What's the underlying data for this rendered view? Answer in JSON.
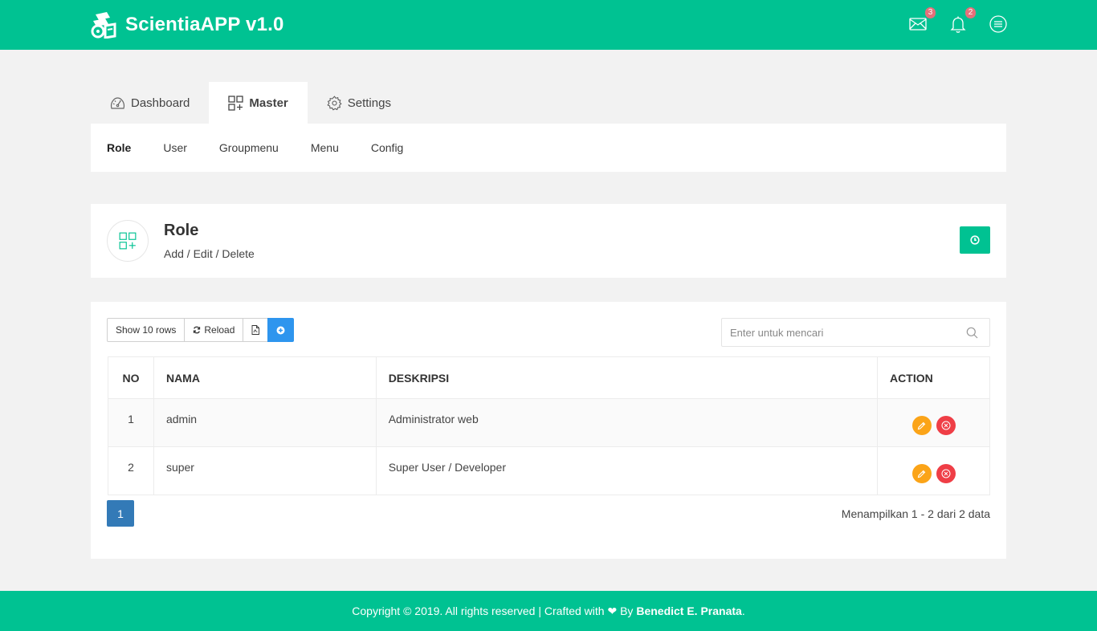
{
  "app": {
    "title": "ScientiaAPP v1.0"
  },
  "header": {
    "mail_count": "3",
    "notif_count": "2"
  },
  "tabs": [
    {
      "label": "Dashboard",
      "icon": "dashboard-gauge-icon"
    },
    {
      "label": "Master",
      "icon": "master-grid-icon",
      "active": true
    },
    {
      "label": "Settings",
      "icon": "gear-icon"
    }
  ],
  "subnav": [
    {
      "label": "Role",
      "active": true
    },
    {
      "label": "User"
    },
    {
      "label": "Groupmenu"
    },
    {
      "label": "Menu"
    },
    {
      "label": "Config"
    }
  ],
  "page": {
    "title": "Role",
    "subtitle": "Add / Edit / Delete"
  },
  "toolbar": {
    "show_rows": "Show 10 rows",
    "reload": "Reload"
  },
  "search": {
    "placeholder": "Enter untuk mencari"
  },
  "table": {
    "headers": [
      "NO",
      "NAMA",
      "DESKRIPSI",
      "ACTION"
    ],
    "rows": [
      {
        "no": "1",
        "nama": "admin",
        "deskripsi": "Administrator web"
      },
      {
        "no": "2",
        "nama": "super",
        "deskripsi": "Super User / Developer"
      }
    ]
  },
  "pagination": {
    "current": "1",
    "info": "Menampilkan 1 - 2 dari 2 data"
  },
  "footer": {
    "text": "Copyright © 2019. All rights reserved | Crafted with ❤ By ",
    "author": "Benedict E. Pranata",
    "end": "."
  },
  "colors": {
    "primary": "#00c292",
    "blue": "#2e95ee",
    "pager": "#337ab7",
    "edit": "#fba418",
    "delete": "#ef3e46",
    "badge": "#e5707a"
  }
}
